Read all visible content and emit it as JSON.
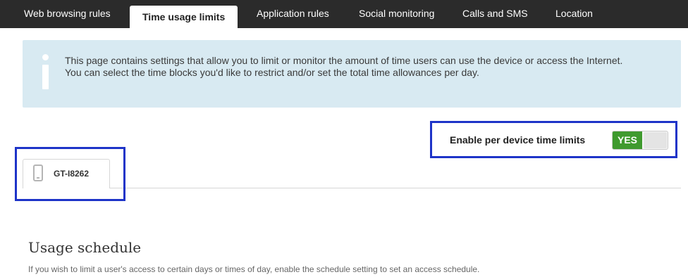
{
  "tabs": [
    {
      "label": "Web browsing rules",
      "active": false
    },
    {
      "label": "Time usage limits",
      "active": true
    },
    {
      "label": "Application rules",
      "active": false
    },
    {
      "label": "Social monitoring",
      "active": false
    },
    {
      "label": "Calls and SMS",
      "active": false
    },
    {
      "label": "Location",
      "active": false
    }
  ],
  "info": {
    "icon": "info-icon",
    "line1": "This page contains settings that allow you to limit or monitor the amount of time users can use the device or access the Internet.",
    "line2": "You can select the time blocks you'd like to restrict and/or set the total time allowances per day."
  },
  "device_limits": {
    "label": "Enable per device time limits",
    "toggle_text": "YES",
    "enabled": true
  },
  "device": {
    "name": "GT-I8262",
    "icon": "phone-icon"
  },
  "schedule": {
    "title": "Usage schedule",
    "description": "If you wish to limit a user's access to certain days or times of day, enable the schedule setting to set an access schedule."
  },
  "colors": {
    "topbar": "#2b2b2b",
    "info_bg": "#d8eaf2",
    "toggle_on": "#3f9a2e",
    "highlight_border": "#1e34c8"
  }
}
